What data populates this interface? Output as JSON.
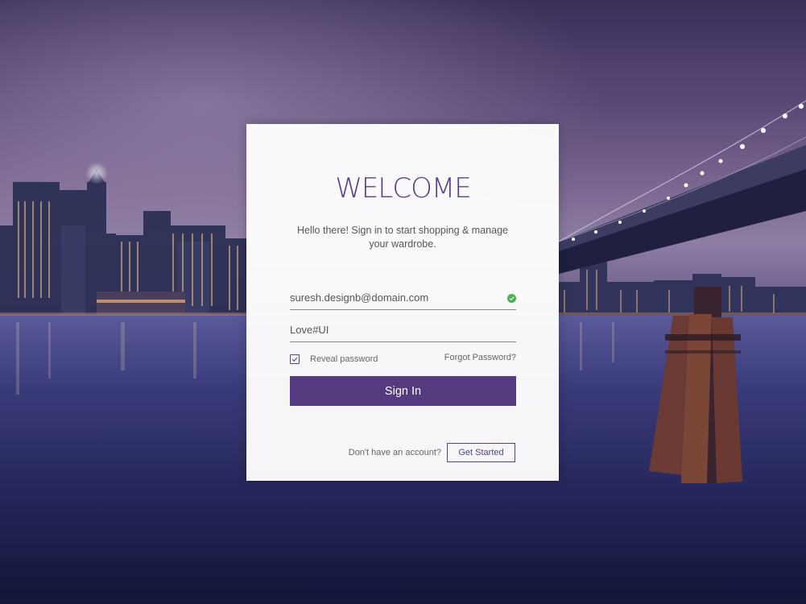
{
  "login": {
    "title": "WELCOME",
    "subtitle_line1": "Hello there! Sign in to start shopping & manage",
    "subtitle_line2": "your  wardrobe.",
    "email_value": "suresh.designb@domain.com",
    "password_value": "Love#UI",
    "reveal_password_label": "Reveal password",
    "reveal_password_checked": true,
    "forgot_password_label": "Forgot Password?",
    "sign_in_label": "Sign In",
    "no_account_text": "Don't have an account?",
    "get_started_label": "Get Started"
  },
  "colors": {
    "accent": "#543a7e",
    "valid_check": "#4caf50"
  },
  "icons": {
    "email_valid": "check-circle-icon",
    "reveal_checkbox": "checkbox-checked-icon"
  }
}
